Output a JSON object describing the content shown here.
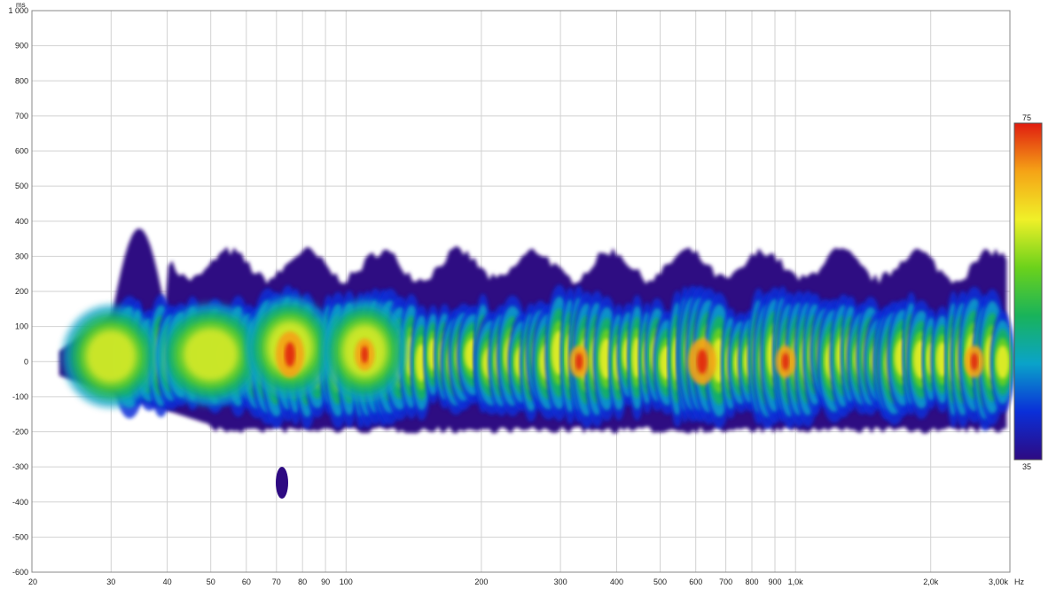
{
  "chart_data": {
    "type": "heatmap",
    "title": "",
    "xlabel": "",
    "ylabel": "",
    "x_unit": "Hz",
    "y_unit": "ms",
    "x_scale": "log",
    "xlim": [
      20,
      3000
    ],
    "ylim": [
      -600,
      1000
    ],
    "grid": true,
    "x_tick_labels": [
      {
        "v": 20,
        "t": "20"
      },
      {
        "v": 30,
        "t": "30"
      },
      {
        "v": 40,
        "t": "40"
      },
      {
        "v": 50,
        "t": "50"
      },
      {
        "v": 60,
        "t": "60"
      },
      {
        "v": 70,
        "t": "70"
      },
      {
        "v": 80,
        "t": "80"
      },
      {
        "v": 90,
        "t": "90"
      },
      {
        "v": 100,
        "t": "100"
      },
      {
        "v": 200,
        "t": "200"
      },
      {
        "v": 300,
        "t": "300"
      },
      {
        "v": 400,
        "t": "400"
      },
      {
        "v": 500,
        "t": "500"
      },
      {
        "v": 600,
        "t": "600"
      },
      {
        "v": 700,
        "t": "700"
      },
      {
        "v": 800,
        "t": "800"
      },
      {
        "v": 900,
        "t": "900"
      },
      {
        "v": 1000,
        "t": "1,0k"
      },
      {
        "v": 2000,
        "t": "2,0k"
      },
      {
        "v": 3000,
        "t": "3,00k"
      }
    ],
    "x_gridlines": [
      20,
      30,
      40,
      50,
      60,
      70,
      80,
      90,
      100,
      200,
      300,
      400,
      500,
      600,
      700,
      800,
      900,
      1000,
      2000,
      3000
    ],
    "y_ticks": [
      1000,
      900,
      800,
      700,
      600,
      500,
      400,
      300,
      200,
      100,
      0,
      -100,
      -200,
      -300,
      -400,
      -500,
      -600
    ],
    "y_tick_labels": [
      "1 000",
      "900",
      "800",
      "700",
      "600",
      "500",
      "400",
      "300",
      "200",
      "100",
      "0",
      "-100",
      "-200",
      "-300",
      "-400",
      "-500",
      "-600"
    ],
    "colorbar": {
      "min": 35,
      "max": 75,
      "min_label": "35",
      "max_label": "75",
      "colors": [
        "#2e0a82",
        "#0a2fd8",
        "#0aa3c9",
        "#19b35a",
        "#6cd21b",
        "#f0f028",
        "#f5a316",
        "#e01c10"
      ]
    },
    "hotspots": [
      {
        "f": 75,
        "t": 20,
        "level": 70
      },
      {
        "f": 110,
        "t": 20,
        "level": 68
      },
      {
        "f": 330,
        "t": 0,
        "level": 68
      },
      {
        "f": 620,
        "t": 0,
        "level": 72
      },
      {
        "f": 950,
        "t": 0,
        "level": 66
      },
      {
        "f": 2500,
        "t": 0,
        "level": 66
      }
    ],
    "islands": [
      {
        "f": 72,
        "t": -345,
        "level": 38
      }
    ]
  }
}
